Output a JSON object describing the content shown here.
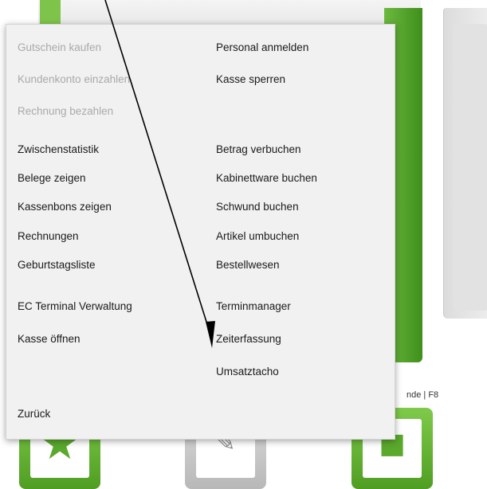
{
  "menu": {
    "left_column": [
      {
        "label": "Gutschein kaufen",
        "enabled": false
      },
      {
        "label": "Kundenkonto einzahlen",
        "enabled": false
      },
      {
        "label": "Rechnung bezahlen",
        "enabled": false
      },
      {
        "label": "Zwischenstatistik",
        "enabled": true
      },
      {
        "label": "Belege zeigen",
        "enabled": true
      },
      {
        "label": "Kassenbons zeigen",
        "enabled": true
      },
      {
        "label": "Rechnungen",
        "enabled": true
      },
      {
        "label": "Geburtstagsliste",
        "enabled": true
      },
      {
        "label": "EC Terminal Verwaltung",
        "enabled": true
      },
      {
        "label": "Kasse öffnen",
        "enabled": true
      }
    ],
    "right_column": [
      {
        "label": "Personal anmelden",
        "enabled": true
      },
      {
        "label": "Kasse sperren",
        "enabled": true
      },
      {
        "label": "Betrag verbuchen",
        "enabled": true
      },
      {
        "label": "Kabinettware buchen",
        "enabled": true
      },
      {
        "label": "Schwund buchen",
        "enabled": true
      },
      {
        "label": "Artikel umbuchen",
        "enabled": true
      },
      {
        "label": "Bestellwesen",
        "enabled": true
      },
      {
        "label": "Terminmanager",
        "enabled": true
      },
      {
        "label": "Zeiterfassung",
        "enabled": true
      },
      {
        "label": "Umsatztacho",
        "enabled": true
      }
    ],
    "back_label": "Zurück"
  },
  "background": {
    "shortcut_label": "nde | F8",
    "accent_green": "#6cb93e",
    "tiles": [
      {
        "icon": "star-icon"
      },
      {
        "icon": "pen-icon"
      },
      {
        "icon": "box-icon"
      }
    ]
  },
  "annotation": {
    "type": "arrow",
    "color": "#000000"
  }
}
